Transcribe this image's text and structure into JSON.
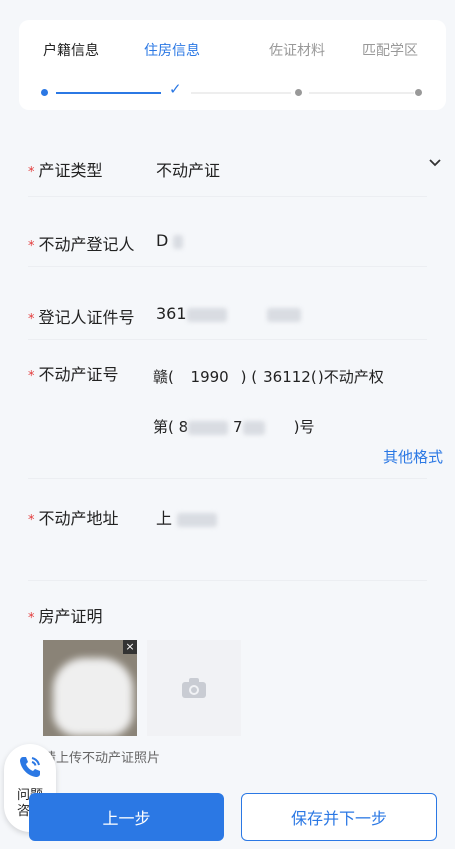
{
  "steps": [
    {
      "label": "户籍信息"
    },
    {
      "label": "住房信息"
    },
    {
      "label": "佐证材料"
    },
    {
      "label": "匹配学区"
    }
  ],
  "form": {
    "cert_type": {
      "label": "产证类型",
      "value": "不动产证"
    },
    "registrant": {
      "label": "不动产登记人",
      "value": "D"
    },
    "id_number": {
      "label": "登记人证件号",
      "value_prefix": "361",
      "value_mid": "",
      "value_suffix": ""
    },
    "cert_number": {
      "label": "不动产证号",
      "prefix": "赣(",
      "year": "1990",
      "close1": ")",
      "open2": "(",
      "region": "36112(",
      "suffix1": ")不动产权",
      "prefix2": "第(",
      "num_start": "8",
      "num_mid": "7",
      "suffix2": ")号"
    },
    "other_format": "其他格式",
    "address": {
      "label": "不动产地址",
      "value": "上"
    },
    "property_proof": {
      "label": "房产证明",
      "hint": "请上传不动产证照片"
    }
  },
  "consult": {
    "line1": "问题",
    "line2": "咨询"
  },
  "buttons": {
    "prev": "上一步",
    "next": "保存并下一步"
  },
  "colors": {
    "accent": "#2b78e4",
    "required": "#e23b3b"
  }
}
